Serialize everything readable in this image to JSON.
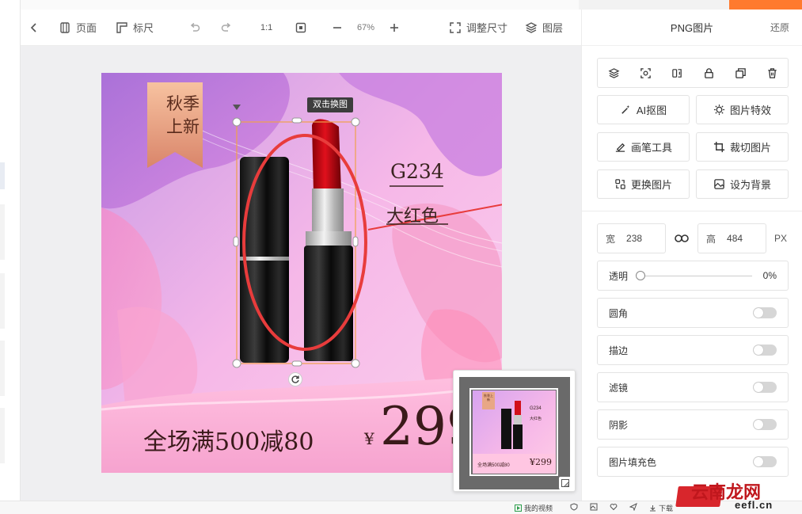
{
  "toolbar": {
    "page_label": "页面",
    "ruler_label": "标尺",
    "ratio_label": "1:1",
    "zoom_value": "67%",
    "resize_label": "调整尺寸",
    "layers_label": "图层"
  },
  "canvas": {
    "tooltip": "双击换图",
    "poster": {
      "badge_text_line1": "秋季",
      "badge_text_line2": "上新",
      "model_code": "G234",
      "color_name": "大红色",
      "promo_text": "全场满500减80",
      "currency": "¥",
      "price": "299"
    }
  },
  "minimap": {
    "badge": "秋季上新",
    "code": "G234",
    "color": "大红色",
    "promo": "全场满500减80",
    "price": "¥299"
  },
  "panel": {
    "title": "PNG图片",
    "reset_label": "还原",
    "actions": {
      "ai_cutout": "AI抠图",
      "effects": "图片特效",
      "brush": "画笔工具",
      "crop": "裁切图片",
      "replace": "更换图片",
      "set_bg": "设为背景"
    },
    "size": {
      "width_label": "宽",
      "width_value": "238",
      "height_label": "高",
      "height_value": "484",
      "unit": "PX"
    },
    "opacity": {
      "label": "透明",
      "value": "0%",
      "level": 0
    },
    "toggles": {
      "round_corner": "圆角",
      "stroke": "描边",
      "filter": "滤镜",
      "shadow": "阴影",
      "fill": "图片填充色"
    }
  },
  "statusbar": {
    "my_video": "我的视频",
    "download": "下载"
  },
  "watermark": {
    "line1": "云南龙网",
    "line2": "eefl.cn"
  },
  "colors": {
    "accent_red": "#e83c3c",
    "poster_pink": "#f4b6e6",
    "selection_orange": "#f0a04b",
    "brand_orange": "#ff7a2e"
  }
}
